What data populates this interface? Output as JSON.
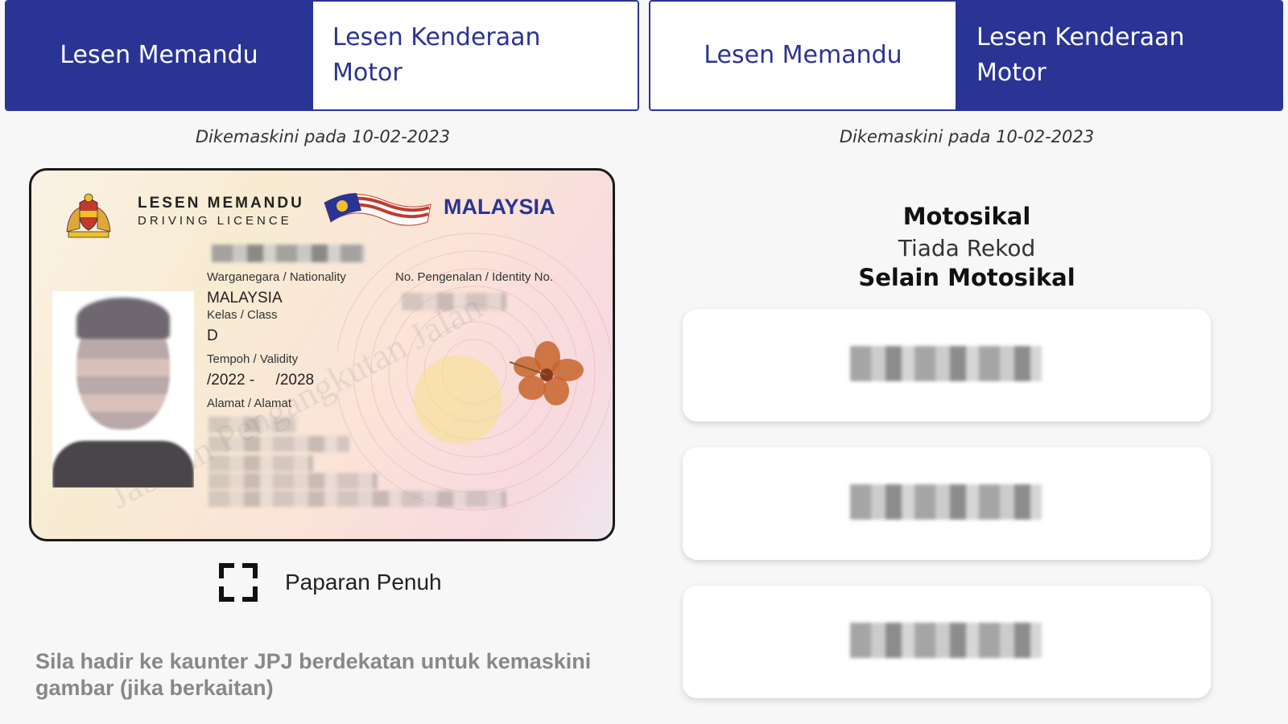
{
  "tabs_left": {
    "driving_licence": "Lesen Memandu",
    "vehicle_licence": "Lesen Kenderaan Motor"
  },
  "tabs_right": {
    "driving_licence": "Lesen Memandu",
    "vehicle_licence": "Lesen Kenderaan Motor"
  },
  "updated_left": "Dikemaskini pada 10-02-2023",
  "updated_right": "Dikemaskini pada 10-02-2023",
  "card": {
    "title_main": "LESEN MEMANDU",
    "title_sub": "DRIVING LICENCE",
    "country": "MALAYSIA",
    "nationality_label": "Warganegara / Nationality",
    "nationality_value": "MALAYSIA",
    "identity_label": "No. Pengenalan / Identity No.",
    "class_label": "Kelas / Class",
    "class_value": "D",
    "validity_label": "Tempoh / Validity",
    "validity_value": "/2022 -     /2028",
    "address_label": "Alamat / Alamat"
  },
  "full_view": {
    "label": "Paparan Penuh",
    "icon": "fullscreen-icon"
  },
  "notice": "Sila hadir ke kaunter JPJ berdekatan untuk kemaskini gambar (jika berkaitan)",
  "vehicles": {
    "motorcycle_title": "Motosikal",
    "motorcycle_value": "Tiada Rekod",
    "other_title": "Selain Motosikal",
    "cards_count": 3
  },
  "colors": {
    "primary": "#2a3494",
    "background": "#f7f7f7"
  }
}
